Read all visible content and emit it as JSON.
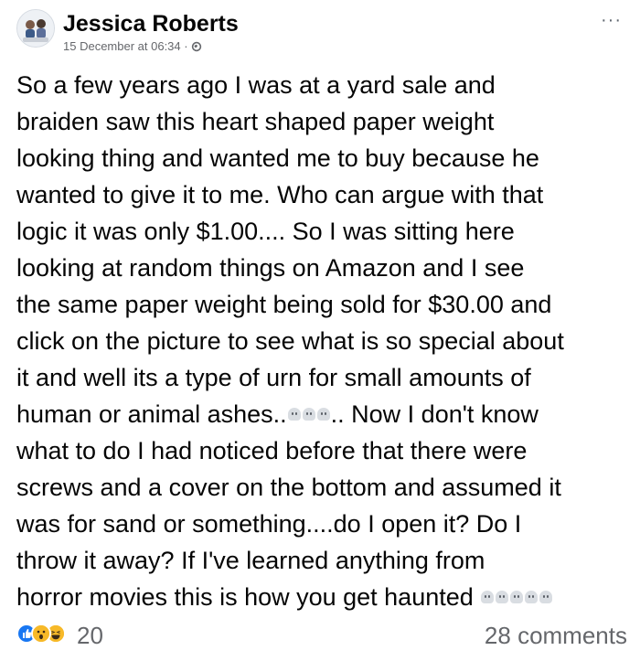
{
  "post": {
    "author": "Jessica Roberts",
    "timestamp": "15 December at 06:34 ·",
    "privacy_icon": "globe-icon",
    "more_label": "···",
    "body_lines": [
      "So a few years ago I was at a yard sale and",
      "braiden saw this heart shaped paper weight",
      "looking thing and wanted me to buy because he",
      "wanted to give it to me. Who can argue with that",
      "logic it was only $1.00.... So I was sitting here",
      "looking at random things on Amazon and I see",
      "the same paper weight being sold for $30.00 and",
      "click on the picture to see what is so special about",
      "it and well its a type of urn for small amounts of"
    ],
    "line_10_start": "human or animal ashes..",
    "line_10_end": ".. Now I don't know",
    "body_lines_2": [
      "what to do I had noticed before that there were",
      "screws and a cover on the bottom and assumed it",
      "was for sand or something....do I open it? Do I",
      "throw it away? If I've learned anything from"
    ],
    "last_line": "horror movies this is how you get haunted ",
    "reactions": [
      "like-icon",
      "wow-icon",
      "haha-icon"
    ],
    "reaction_count": "20",
    "comments_label": "28 comments"
  },
  "colors": {
    "text": "#050505",
    "secondary": "#65676b",
    "like": "#1877f2",
    "wow": "#f7b928"
  }
}
